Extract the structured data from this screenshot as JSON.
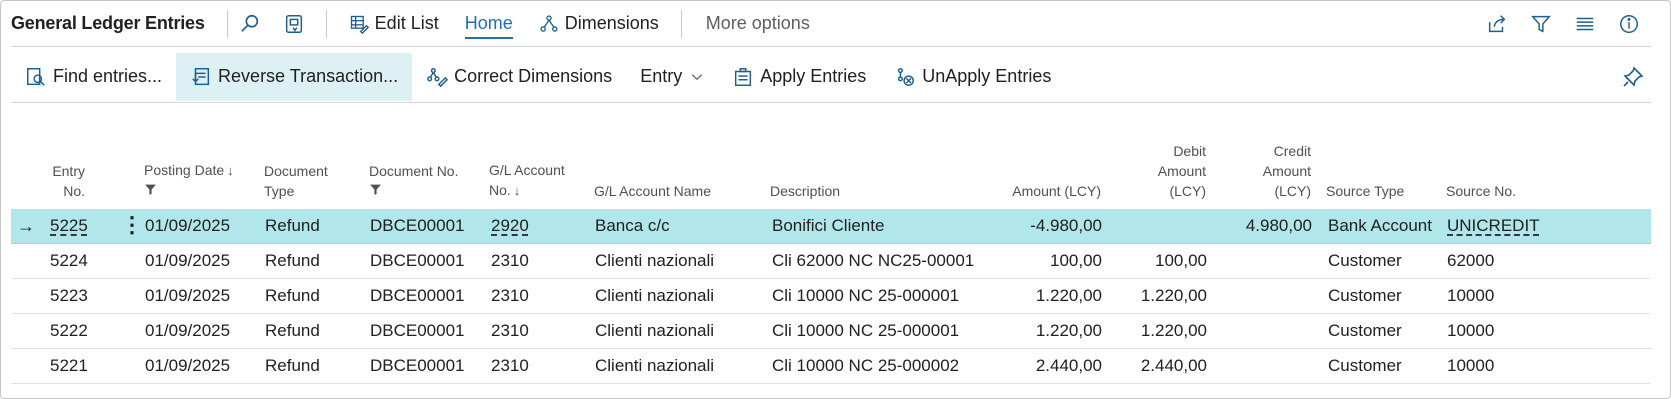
{
  "header": {
    "title": "General Ledger Entries",
    "edit_list": "Edit List",
    "home": "Home",
    "dimensions": "Dimensions",
    "more_options": "More options"
  },
  "actions": {
    "find_entries": "Find entries...",
    "reverse_transaction": "Reverse Transaction...",
    "correct_dimensions": "Correct Dimensions",
    "entry": "Entry",
    "apply_entries": "Apply Entries",
    "unapply_entries": "UnApply Entries"
  },
  "columns": {
    "entry_no": [
      "Entry",
      "No."
    ],
    "posting_date": "Posting Date",
    "document_type": [
      "Document",
      "Type"
    ],
    "document_no": "Document No.",
    "gl_account_no": [
      "G/L Account",
      "No."
    ],
    "gl_account_name": "G/L Account Name",
    "description": "Description",
    "amount": "Amount (LCY)",
    "debit_amount": [
      "Debit",
      "Amount",
      "(LCY)"
    ],
    "credit_amount": [
      "Credit",
      "Amount",
      "(LCY)"
    ],
    "source_type": "Source Type",
    "source_no": "Source No."
  },
  "sort_arrow": "↓",
  "row_menu_glyph": "⋮",
  "row_arrow_glyph": "→",
  "rows": [
    {
      "entry_no": "5225",
      "posting_date": "01/09/2025",
      "document_type": "Refund",
      "document_no": "DBCE00001",
      "gl_account_no": "2920",
      "gl_account_name": "Banca c/c",
      "description": "Bonifici Cliente",
      "amount": "-4.980,00",
      "debit": "",
      "credit": "4.980,00",
      "source_type": "Bank Account",
      "source_no": "UNICREDIT"
    },
    {
      "entry_no": "5224",
      "posting_date": "01/09/2025",
      "document_type": "Refund",
      "document_no": "DBCE00001",
      "gl_account_no": "2310",
      "gl_account_name": "Clienti nazionali",
      "description": "Cli 62000 NC NC25-00001",
      "amount": "100,00",
      "debit": "100,00",
      "credit": "",
      "source_type": "Customer",
      "source_no": "62000"
    },
    {
      "entry_no": "5223",
      "posting_date": "01/09/2025",
      "document_type": "Refund",
      "document_no": "DBCE00001",
      "gl_account_no": "2310",
      "gl_account_name": "Clienti nazionali",
      "description": "Cli 10000 NC 25-000001",
      "amount": "1.220,00",
      "debit": "1.220,00",
      "credit": "",
      "source_type": "Customer",
      "source_no": "10000"
    },
    {
      "entry_no": "5222",
      "posting_date": "01/09/2025",
      "document_type": "Refund",
      "document_no": "DBCE00001",
      "gl_account_no": "2310",
      "gl_account_name": "Clienti nazionali",
      "description": "Cli 10000 NC 25-000001",
      "amount": "1.220,00",
      "debit": "1.220,00",
      "credit": "",
      "source_type": "Customer",
      "source_no": "10000"
    },
    {
      "entry_no": "5221",
      "posting_date": "01/09/2025",
      "document_type": "Refund",
      "document_no": "DBCE00001",
      "gl_account_no": "2310",
      "gl_account_name": "Clienti nazionali",
      "description": "Cli 10000 NC 25-000002",
      "amount": "2.440,00",
      "debit": "2.440,00",
      "credit": "",
      "source_type": "Customer",
      "source_no": "10000"
    }
  ],
  "colors": {
    "accent": "#1f6fb2",
    "icon": "#1f5f8b",
    "selected_row": "#b1e6ea",
    "active_action": "#ddf0f3"
  },
  "icons": [
    "search-icon",
    "bookmark-icon",
    "edit-list-icon",
    "dimensions-icon",
    "share-icon",
    "filter-icon",
    "list-icon",
    "info-icon",
    "find-entries-icon",
    "reverse-transaction-icon",
    "correct-dimensions-icon",
    "chevron-down-icon",
    "apply-entries-icon",
    "unapply-entries-icon",
    "pin-icon",
    "filter-small-icon"
  ]
}
